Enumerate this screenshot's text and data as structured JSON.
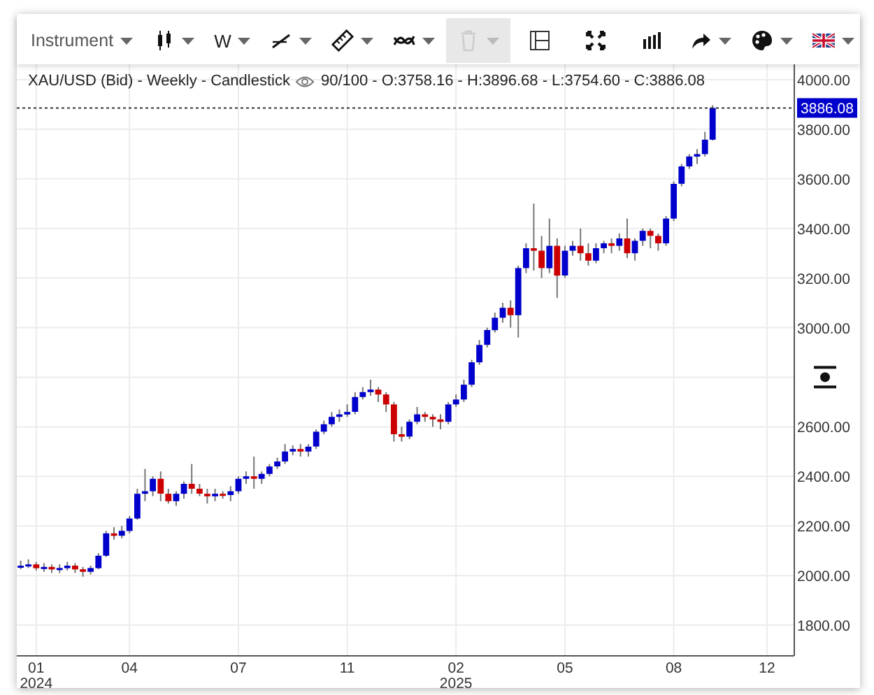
{
  "toolbar": [
    {
      "kind": "dropdown",
      "label": "Instrument",
      "disabled": false
    },
    {
      "kind": "icon-dropdown",
      "disabled": false
    },
    {
      "kind": "dropdown",
      "label": "W",
      "disabled": false
    },
    {
      "kind": "icon-dropdown",
      "disabled": false
    },
    {
      "kind": "icon-dropdown",
      "disabled": false
    },
    {
      "kind": "icon-dropdown",
      "disabled": false
    },
    {
      "kind": "icon-dropdown",
      "disabled": true
    },
    {
      "kind": "icon",
      "disabled": false
    },
    {
      "kind": "icon",
      "disabled": false
    },
    {
      "kind": "icon",
      "disabled": false
    },
    {
      "kind": "icon-dropdown",
      "disabled": false
    },
    {
      "kind": "icon-dropdown",
      "disabled": false
    },
    {
      "kind": "icon-dropdown",
      "disabled": false
    }
  ],
  "chart": {
    "title": "XAU/USD (Bid) - Weekly - Candlestick",
    "stats": "90/100 - O:3758.16 - H:3896.68 - L:3754.60 - C:3886.08",
    "chart_data": {
      "type": "candlestick",
      "grid": true,
      "ylim": [
        1676,
        4062
      ],
      "yticks": [
        {
          "value": 1800,
          "label": "1800.00"
        },
        {
          "value": 2000,
          "label": "2000.00"
        },
        {
          "value": 2200,
          "label": "2200.00"
        },
        {
          "value": 2400,
          "label": "2400.00"
        },
        {
          "value": 2600,
          "label": "2600.00"
        },
        {
          "value": 3000,
          "label": "3000.00"
        },
        {
          "value": 3200,
          "label": "3200.00"
        },
        {
          "value": 3400,
          "label": "3400.00"
        },
        {
          "value": 3600,
          "label": "3600.00"
        },
        {
          "value": 3800,
          "label": "3800.00"
        },
        {
          "value": 4000,
          "label": "4000.00"
        }
      ],
      "ref_lines": [
        {
          "axis": "y",
          "value": 3886.08,
          "label": "3886.08"
        }
      ],
      "categories": [
        null,
        null,
        "01\n2024",
        null,
        null,
        null,
        null,
        null,
        null,
        null,
        null,
        null,
        null,
        null,
        "04",
        null,
        null,
        null,
        null,
        null,
        null,
        null,
        null,
        null,
        null,
        null,
        null,
        null,
        "07",
        null,
        null,
        null,
        null,
        null,
        null,
        null,
        null,
        null,
        null,
        null,
        null,
        null,
        "11",
        null,
        null,
        null,
        null,
        null,
        null,
        null,
        null,
        null,
        null,
        null,
        null,
        null,
        "02\n2025",
        null,
        null,
        null,
        null,
        null,
        null,
        null,
        null,
        null,
        null,
        null,
        null,
        null,
        "05",
        null,
        null,
        null,
        null,
        null,
        null,
        null,
        null,
        null,
        null,
        null,
        null,
        null,
        "08",
        null,
        null,
        null,
        null,
        null,
        null,
        null,
        null,
        null,
        null,
        null,
        "12",
        null,
        null,
        null
      ],
      "ohlc": [
        [
          2035,
          2060,
          2025,
          2040
        ],
        [
          2040,
          2065,
          2030,
          2045
        ],
        [
          2045,
          2055,
          2020,
          2030
        ],
        [
          2030,
          2050,
          2015,
          2035
        ],
        [
          2035,
          2045,
          2010,
          2025
        ],
        [
          2025,
          2045,
          2010,
          2030
        ],
        [
          2030,
          2055,
          2020,
          2040
        ],
        [
          2040,
          2050,
          2010,
          2025
        ],
        [
          2025,
          2035,
          1995,
          2015
        ],
        [
          2015,
          2040,
          2005,
          2030
        ],
        [
          2030,
          2090,
          2025,
          2080
        ],
        [
          2080,
          2180,
          2075,
          2170
        ],
        [
          2170,
          2195,
          2145,
          2160
        ],
        [
          2160,
          2200,
          2150,
          2180
        ],
        [
          2180,
          2240,
          2170,
          2230
        ],
        [
          2230,
          2350,
          2225,
          2330
        ],
        [
          2330,
          2430,
          2300,
          2340
        ],
        [
          2340,
          2400,
          2320,
          2390
        ],
        [
          2390,
          2420,
          2300,
          2330
        ],
        [
          2330,
          2350,
          2290,
          2300
        ],
        [
          2300,
          2340,
          2280,
          2330
        ],
        [
          2330,
          2380,
          2310,
          2370
        ],
        [
          2370,
          2450,
          2330,
          2350
        ],
        [
          2350,
          2370,
          2320,
          2330
        ],
        [
          2330,
          2350,
          2290,
          2320
        ],
        [
          2320,
          2350,
          2300,
          2330
        ],
        [
          2330,
          2340,
          2310,
          2325
        ],
        [
          2325,
          2360,
          2300,
          2340
        ],
        [
          2340,
          2400,
          2330,
          2390
        ],
        [
          2390,
          2420,
          2370,
          2400
        ],
        [
          2400,
          2480,
          2350,
          2390
        ],
        [
          2390,
          2420,
          2370,
          2410
        ],
        [
          2410,
          2450,
          2400,
          2440
        ],
        [
          2440,
          2475,
          2430,
          2460
        ],
        [
          2460,
          2530,
          2450,
          2500
        ],
        [
          2500,
          2525,
          2485,
          2510
        ],
        [
          2510,
          2530,
          2480,
          2500
        ],
        [
          2500,
          2530,
          2480,
          2520
        ],
        [
          2520,
          2590,
          2510,
          2580
        ],
        [
          2580,
          2625,
          2570,
          2610
        ],
        [
          2610,
          2660,
          2600,
          2640
        ],
        [
          2640,
          2670,
          2620,
          2650
        ],
        [
          2650,
          2690,
          2640,
          2660
        ],
        [
          2660,
          2740,
          2650,
          2720
        ],
        [
          2720,
          2760,
          2710,
          2740
        ],
        [
          2740,
          2790,
          2725,
          2750
        ],
        [
          2750,
          2760,
          2700,
          2730
        ],
        [
          2730,
          2740,
          2660,
          2690
        ],
        [
          2690,
          2700,
          2540,
          2570
        ],
        [
          2570,
          2600,
          2540,
          2560
        ],
        [
          2560,
          2630,
          2550,
          2620
        ],
        [
          2620,
          2680,
          2610,
          2650
        ],
        [
          2650,
          2660,
          2620,
          2640
        ],
        [
          2640,
          2650,
          2600,
          2630
        ],
        [
          2630,
          2650,
          2590,
          2620
        ],
        [
          2620,
          2700,
          2610,
          2690
        ],
        [
          2690,
          2730,
          2680,
          2710
        ],
        [
          2710,
          2790,
          2700,
          2770
        ],
        [
          2770,
          2870,
          2760,
          2860
        ],
        [
          2860,
          2950,
          2850,
          2930
        ],
        [
          2930,
          3000,
          2920,
          2990
        ],
        [
          2990,
          3060,
          2980,
          3040
        ],
        [
          3040,
          3100,
          3020,
          3080
        ],
        [
          3080,
          3110,
          3000,
          3050
        ],
        [
          3050,
          3250,
          2960,
          3240
        ],
        [
          3240,
          3340,
          3220,
          3320
        ],
        [
          3320,
          3500,
          3230,
          3310
        ],
        [
          3310,
          3370,
          3200,
          3240
        ],
        [
          3240,
          3440,
          3220,
          3330
        ],
        [
          3330,
          3360,
          3120,
          3210
        ],
        [
          3210,
          3330,
          3200,
          3310
        ],
        [
          3310,
          3350,
          3290,
          3330
        ],
        [
          3330,
          3400,
          3270,
          3300
        ],
        [
          3300,
          3340,
          3250,
          3270
        ],
        [
          3270,
          3340,
          3260,
          3320
        ],
        [
          3320,
          3350,
          3300,
          3340
        ],
        [
          3340,
          3360,
          3300,
          3330
        ],
        [
          3330,
          3380,
          3310,
          3360
        ],
        [
          3360,
          3440,
          3280,
          3300
        ],
        [
          3300,
          3360,
          3270,
          3350
        ],
        [
          3350,
          3400,
          3330,
          3390
        ],
        [
          3390,
          3400,
          3320,
          3370
        ],
        [
          3370,
          3380,
          3310,
          3340
        ],
        [
          3340,
          3450,
          3330,
          3440
        ],
        [
          3440,
          3590,
          3430,
          3580
        ],
        [
          3580,
          3660,
          3570,
          3650
        ],
        [
          3650,
          3700,
          3640,
          3690
        ],
        [
          3690,
          3720,
          3660,
          3700
        ],
        [
          3700,
          3790,
          3690,
          3758.16
        ],
        [
          3758.16,
          3896.68,
          3754.6,
          3886.08
        ],
        null,
        null,
        null,
        null,
        null,
        null,
        null,
        null,
        null,
        null
      ]
    }
  }
}
